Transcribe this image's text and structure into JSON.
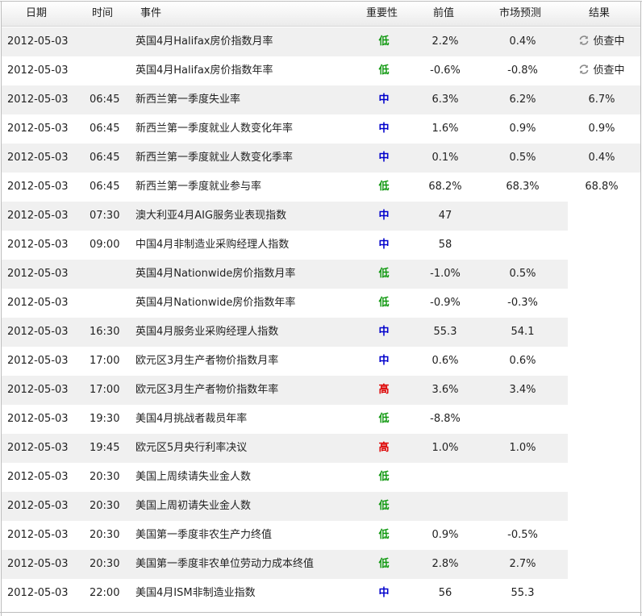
{
  "header": {
    "date": "日期",
    "time": "时间",
    "event": "事件",
    "importance": "重要性",
    "previous": "前值",
    "forecast": "市场预测",
    "result": "结果"
  },
  "colors": {
    "low": "#119911",
    "medium": "#0000cc",
    "high": "#dd0000",
    "row_shade": "#f0f0f0"
  },
  "rows": [
    {
      "date": "2012-05-03",
      "time": "",
      "event": "英国4月Halifax房价指数月率",
      "importance": "低",
      "level": "low",
      "previous": "2.2%",
      "forecast": "0.4%",
      "result": "侦查中",
      "result_icon": "refresh-icon"
    },
    {
      "date": "2012-05-03",
      "time": "",
      "event": "英国4月Halifax房价指数年率",
      "importance": "低",
      "level": "low",
      "previous": "-0.6%",
      "forecast": "-0.8%",
      "result": "侦查中",
      "result_icon": "refresh-icon"
    },
    {
      "date": "2012-05-03",
      "time": "06:45",
      "event": "新西兰第一季度失业率",
      "importance": "中",
      "level": "medium",
      "previous": "6.3%",
      "forecast": "6.2%",
      "result": "6.7%"
    },
    {
      "date": "2012-05-03",
      "time": "06:45",
      "event": "新西兰第一季度就业人数变化年率",
      "importance": "中",
      "level": "medium",
      "previous": "1.6%",
      "forecast": "0.9%",
      "result": "0.9%"
    },
    {
      "date": "2012-05-03",
      "time": "06:45",
      "event": "新西兰第一季度就业人数变化季率",
      "importance": "中",
      "level": "medium",
      "previous": "0.1%",
      "forecast": "0.5%",
      "result": "0.4%"
    },
    {
      "date": "2012-05-03",
      "time": "06:45",
      "event": "新西兰第一季度就业参与率",
      "importance": "低",
      "level": "low",
      "previous": "68.2%",
      "forecast": "68.3%",
      "result": "68.8%"
    },
    {
      "date": "2012-05-03",
      "time": "07:30",
      "event": "澳大利亚4月AIG服务业表现指数",
      "importance": "中",
      "level": "medium",
      "previous": "47",
      "forecast": "",
      "result": ""
    },
    {
      "date": "2012-05-03",
      "time": "09:00",
      "event": "中国4月非制造业采购经理人指数",
      "importance": "中",
      "level": "medium",
      "previous": "58",
      "forecast": "",
      "result": ""
    },
    {
      "date": "2012-05-03",
      "time": "",
      "event": "英国4月Nationwide房价指数月率",
      "importance": "低",
      "level": "low",
      "previous": "-1.0%",
      "forecast": "0.5%",
      "result": ""
    },
    {
      "date": "2012-05-03",
      "time": "",
      "event": "英国4月Nationwide房价指数年率",
      "importance": "低",
      "level": "low",
      "previous": "-0.9%",
      "forecast": "-0.3%",
      "result": ""
    },
    {
      "date": "2012-05-03",
      "time": "16:30",
      "event": "英国4月服务业采购经理人指数",
      "importance": "中",
      "level": "medium",
      "previous": "55.3",
      "forecast": "54.1",
      "result": ""
    },
    {
      "date": "2012-05-03",
      "time": "17:00",
      "event": "欧元区3月生产者物价指数月率",
      "importance": "中",
      "level": "medium",
      "previous": "0.6%",
      "forecast": "0.6%",
      "result": ""
    },
    {
      "date": "2012-05-03",
      "time": "17:00",
      "event": "欧元区3月生产者物价指数年率",
      "importance": "高",
      "level": "high",
      "previous": "3.6%",
      "forecast": "3.4%",
      "result": ""
    },
    {
      "date": "2012-05-03",
      "time": "19:30",
      "event": "美国4月挑战者裁员年率",
      "importance": "低",
      "level": "low",
      "previous": "-8.8%",
      "forecast": "",
      "result": ""
    },
    {
      "date": "2012-05-03",
      "time": "19:45",
      "event": "欧元区5月央行利率决议",
      "importance": "高",
      "level": "high",
      "previous": "1.0%",
      "forecast": "1.0%",
      "result": ""
    },
    {
      "date": "2012-05-03",
      "time": "20:30",
      "event": "美国上周续请失业金人数",
      "importance": "低",
      "level": "low",
      "previous": "",
      "forecast": "",
      "result": ""
    },
    {
      "date": "2012-05-03",
      "time": "20:30",
      "event": "美国上周初请失业金人数",
      "importance": "低",
      "level": "low",
      "previous": "",
      "forecast": "",
      "result": ""
    },
    {
      "date": "2012-05-03",
      "time": "20:30",
      "event": "美国第一季度非农生产力终值",
      "importance": "低",
      "level": "low",
      "previous": "0.9%",
      "forecast": "-0.5%",
      "result": ""
    },
    {
      "date": "2012-05-03",
      "time": "20:30",
      "event": "美国第一季度非农单位劳动力成本终值",
      "importance": "低",
      "level": "low",
      "previous": "2.8%",
      "forecast": "2.7%",
      "result": ""
    },
    {
      "date": "2012-05-03",
      "time": "22:00",
      "event": "美国4月ISM非制造业指数",
      "importance": "中",
      "level": "medium",
      "previous": "56",
      "forecast": "55.3",
      "result": ""
    }
  ]
}
